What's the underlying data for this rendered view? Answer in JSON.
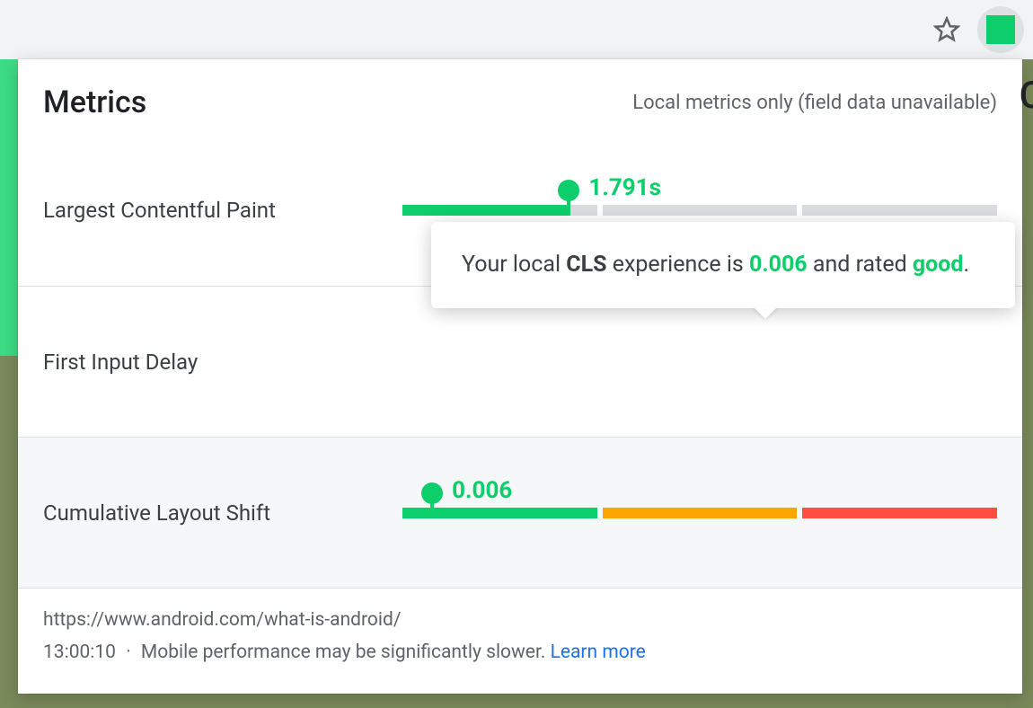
{
  "colors": {
    "good": "#0cce6b",
    "ok": "#ffa400",
    "poor": "#ff4e42",
    "neutral": "#dadce0",
    "link": "#1a73e8"
  },
  "header": {
    "title": "Metrics",
    "subtitle": "Local metrics only (field data unavailable)"
  },
  "metrics": [
    {
      "id": "lcp",
      "label": "Largest Contentful Paint",
      "value": "1.791s",
      "marker_pct": 28,
      "segments": [
        "good",
        "neutral",
        "neutral"
      ],
      "good_segment_fill_pct": 85
    },
    {
      "id": "fid",
      "label": "First Input Delay",
      "value": "",
      "marker_pct": null,
      "segments": []
    },
    {
      "id": "cls",
      "label": "Cumulative Layout Shift",
      "value": "0.006",
      "marker_pct": 5,
      "segments": [
        "good",
        "ok",
        "poor"
      ],
      "good_segment_fill_pct": 100
    }
  ],
  "tooltip": {
    "prefix": "Your local ",
    "abbr": "CLS",
    "middle": " experience is ",
    "value": "0.006",
    "after_value": " and rated ",
    "rating": "good",
    "suffix": "."
  },
  "footer": {
    "url": "https://www.android.com/what-is-android/",
    "time": "13:00:10",
    "separator": " · ",
    "warning": "Mobile performance may be significantly slower. ",
    "learn_more": "Learn more"
  }
}
